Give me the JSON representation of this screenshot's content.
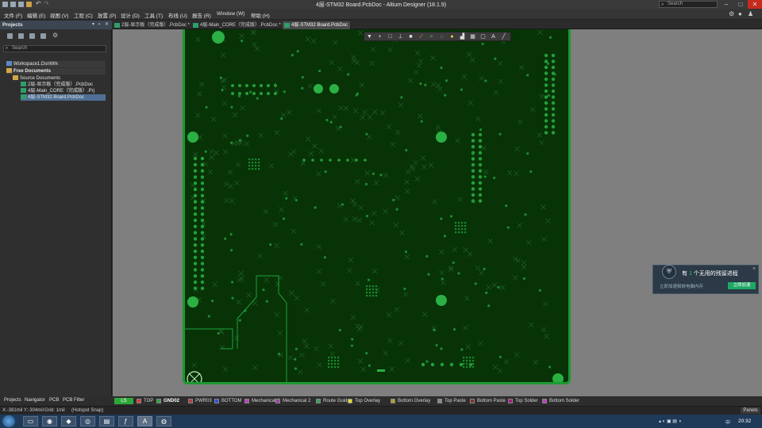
{
  "window": {
    "title": "4层-STM32 Board.PcbDoc - Altium Designer (18.1.9)",
    "search_placeholder": "Search",
    "controls": [
      "–",
      "□",
      "✕"
    ]
  },
  "menubar": {
    "items": [
      "文件 (F)",
      "编辑 (E)",
      "视图 (V)",
      "工程 (C)",
      "放置 (P)",
      "设计 (D)",
      "工具 (T)",
      "布线 (U)",
      "报告 (R)",
      "Window (W)",
      "帮助 (H)"
    ]
  },
  "projects_panel": {
    "title": "Projects",
    "header_controls": [
      "▾",
      "▪",
      "✕"
    ],
    "search_placeholder": "Search",
    "tree": [
      {
        "label": "Workspace1.DsnWrk",
        "indent": 1,
        "icon": "workspace-icon"
      },
      {
        "label": "Free Documents",
        "indent": 1,
        "icon": "folder-icon"
      },
      {
        "label": "Source Documents",
        "indent": 2,
        "icon": "folder-icon"
      },
      {
        "label": "2层-显示板（完成版）.PcbDoc",
        "indent": 3,
        "icon": "pcb-doc-icon"
      },
      {
        "label": "4层-Main_CORE（完成版）.Prj",
        "indent": 3,
        "icon": "project-icon"
      },
      {
        "label": "4层-STM32 Board.PcbDoc",
        "indent": 3,
        "icon": "pcb-doc-icon",
        "selected": true
      }
    ]
  },
  "doc_tabs": [
    {
      "label": "2层-显示板（完成版）.PcbDoc *",
      "active": false
    },
    {
      "label": "4层-Main_CORE（完成版）.PcbDoc *",
      "active": false
    },
    {
      "label": "4层-STM32 Board.PcbDoc",
      "active": true
    }
  ],
  "notification": {
    "title_pre": "有 ",
    "title_count": "1",
    "title_post": " 个无用的残留进程",
    "description": "立即加速释放电脑内存",
    "button": "立即加速",
    "close": "×"
  },
  "panel_tabs": [
    "Projects",
    "Navigator",
    "PCB",
    "PCB Filter"
  ],
  "layers": {
    "current": "LS",
    "items": [
      {
        "name": "TOP",
        "color": "#e03a3a"
      },
      {
        "name": "GND02",
        "color": "#2fa83b",
        "active": true
      },
      {
        "name": "PWR03",
        "color": "#b04040"
      },
      {
        "name": "BOTTOM",
        "color": "#2b52d8"
      },
      {
        "name": "Mechanical 1",
        "color": "#c040c0"
      },
      {
        "name": "Mechanical 2",
        "color": "#a040a0"
      },
      {
        "name": "Route Guide",
        "color": "#3aa060"
      },
      {
        "name": "Top Overlay",
        "color": "#e6e02a"
      },
      {
        "name": "Bottom Overlay",
        "color": "#b0a030"
      },
      {
        "name": "Top Paste",
        "color": "#888888"
      },
      {
        "name": "Bottom Paste",
        "color": "#803030"
      },
      {
        "name": "Top Solder",
        "color": "#a02080"
      },
      {
        "name": "Bottom Solder",
        "color": "#c040c0"
      }
    ]
  },
  "status": {
    "coords": "X:-381mil Y:-304mil",
    "grid": "Grid: 1mil",
    "snap": "(Hotspot Snap)",
    "panels_button": "Panels"
  },
  "taskbar": {
    "tray_text": "中",
    "clock": "20:32"
  }
}
